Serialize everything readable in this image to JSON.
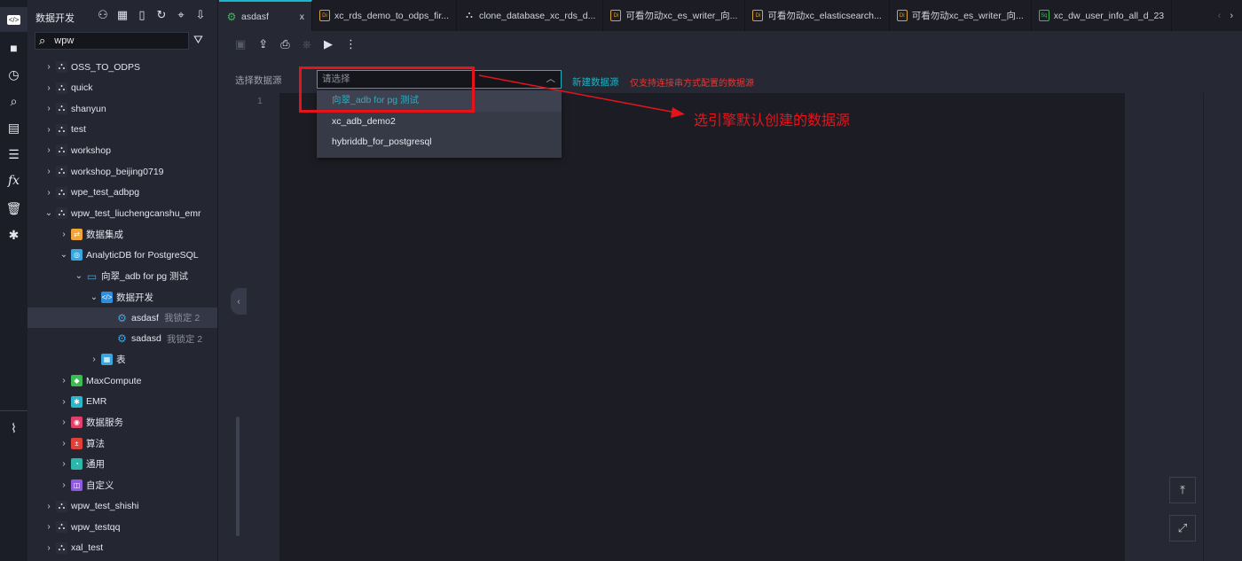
{
  "sidebar": {
    "title": "数据开发",
    "search_value": "wpw",
    "tree": [
      {
        "label": "OSS_TO_ODPS",
        "level": 1,
        "icon": "workflow-icon",
        "expanded": false
      },
      {
        "label": "quick",
        "level": 1,
        "icon": "workflow-icon",
        "expanded": false
      },
      {
        "label": "shanyun",
        "level": 1,
        "icon": "workflow-icon",
        "expanded": false
      },
      {
        "label": "test",
        "level": 1,
        "icon": "workflow-icon",
        "expanded": false
      },
      {
        "label": "workshop",
        "level": 1,
        "icon": "workflow-icon",
        "expanded": false
      },
      {
        "label": "workshop_beijing0719",
        "level": 1,
        "icon": "workflow-icon",
        "expanded": false
      },
      {
        "label": "wpe_test_adbpg",
        "level": 1,
        "icon": "workflow-icon",
        "expanded": false
      },
      {
        "label": "wpw_test_liuchengcanshu_emr",
        "level": 1,
        "icon": "workflow-icon",
        "expanded": true
      },
      {
        "label": "数据集成",
        "level": 2,
        "icon": "data-integration-icon",
        "expanded": false
      },
      {
        "label": "AnalyticDB for PostgreSQL",
        "level": 2,
        "icon": "analyticdb-icon",
        "expanded": true
      },
      {
        "label": "向翠_adb for pg 测试",
        "level": 3,
        "icon": "database-icon",
        "expanded": true
      },
      {
        "label": "数据开发",
        "level": 4,
        "icon": "code-icon",
        "expanded": true
      },
      {
        "label": "asdasf",
        "level": 5,
        "icon": "node-gear-icon",
        "meta": "我锁定 2",
        "selected": true
      },
      {
        "label": "sadasd",
        "level": 5,
        "icon": "node-gear-icon",
        "meta": "我锁定 2"
      },
      {
        "label": "表",
        "level": 4,
        "icon": "table-icon",
        "expanded": false
      },
      {
        "label": "MaxCompute",
        "level": 2,
        "icon": "maxcompute-icon",
        "expanded": false
      },
      {
        "label": "EMR",
        "level": 2,
        "icon": "emr-icon",
        "expanded": false
      },
      {
        "label": "数据服务",
        "level": 2,
        "icon": "data-service-icon",
        "expanded": false
      },
      {
        "label": "算法",
        "level": 2,
        "icon": "algorithm-icon",
        "expanded": false
      },
      {
        "label": "通用",
        "level": 2,
        "icon": "general-icon",
        "expanded": false
      },
      {
        "label": "自定义",
        "level": 2,
        "icon": "custom-icon",
        "expanded": false
      },
      {
        "label": "wpw_test_shishi",
        "level": 1,
        "icon": "workflow-icon",
        "expanded": false
      },
      {
        "label": "wpw_testqq",
        "level": 1,
        "icon": "workflow-icon",
        "expanded": false
      },
      {
        "label": "xal_test",
        "level": 1,
        "icon": "workflow-icon",
        "expanded": false
      }
    ]
  },
  "tabs": [
    {
      "label": "asdasf",
      "icon": "node-gear-icon",
      "active": true,
      "close": "x"
    },
    {
      "label": "xc_rds_demo_to_odps_fir...",
      "icon": "di-icon"
    },
    {
      "label": "clone_database_xc_rds_d...",
      "icon": "workflow-icon"
    },
    {
      "label": "可看勿动xc_es_writer_向...",
      "icon": "di-icon"
    },
    {
      "label": "可看勿动xc_elasticsearch...",
      "icon": "di-icon"
    },
    {
      "label": "可看勿动xc_es_writer_向...",
      "icon": "di-icon"
    },
    {
      "label": "xc_dw_user_info_all_d_23",
      "icon": "sql-icon"
    }
  ],
  "form": {
    "label": "选择数据源",
    "placeholder": "请选择",
    "new_datasource": "新建数据源",
    "warning": "仅支持连接串方式配置的数据源",
    "options": [
      "向翠_adb for pg 测试",
      "xc_adb_demo2",
      "hybriddb_for_postgresql"
    ],
    "highlighted": 0
  },
  "editor": {
    "line_number": "1"
  },
  "annotation": {
    "text": "选引擎默认创建的数据源",
    "color": "#e5141b"
  },
  "colors": {
    "accent": "#19b7c9",
    "warning": "#e53935"
  }
}
